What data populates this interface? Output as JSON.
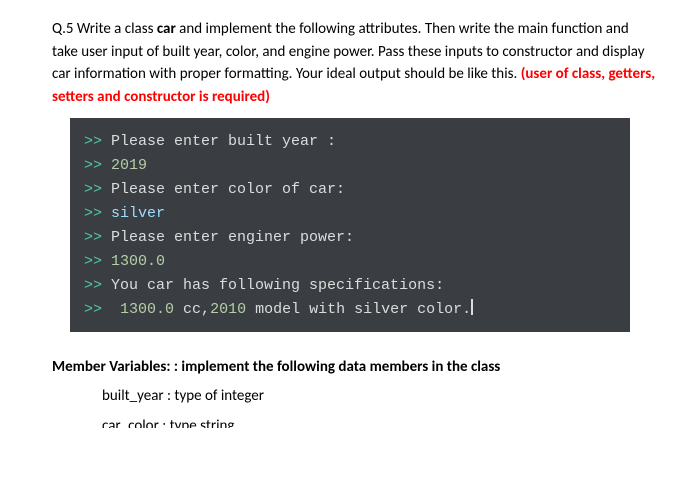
{
  "question": {
    "label": "Q.5",
    "part1": " Write a class ",
    "bold_word": "car",
    "part2": " and implement the following attributes. Then write the main function and take user input of built year, color, and engine power. Pass these inputs to constructor and display car information with proper formatting. Your ideal output should be like this. ",
    "red_text": "(user of class, getters, setters and constructor is required)"
  },
  "terminal": {
    "lines": [
      {
        "prompt": ">> ",
        "segments": [
          {
            "text": "Please enter built year :",
            "cls": "plain-text"
          }
        ]
      },
      {
        "prompt": ">> ",
        "segments": [
          {
            "text": "2019",
            "cls": "num-text"
          }
        ]
      },
      {
        "prompt": ">> ",
        "segments": [
          {
            "text": "Please enter color of car:",
            "cls": "plain-text"
          }
        ]
      },
      {
        "prompt": ">> ",
        "segments": [
          {
            "text": "silver",
            "cls": "cyan-text"
          }
        ]
      },
      {
        "prompt": ">> ",
        "segments": [
          {
            "text": "Please enter enginer power:",
            "cls": "plain-text"
          }
        ]
      },
      {
        "prompt": ">> ",
        "segments": [
          {
            "text": "1300.0",
            "cls": "num-text"
          }
        ]
      },
      {
        "prompt": ">> ",
        "segments": [
          {
            "text": "You car has following specifications:",
            "cls": "plain-text"
          }
        ]
      },
      {
        "prompt": ">> ",
        "segments": [
          {
            "text": " ",
            "cls": "plain-text"
          },
          {
            "text": "1300.0",
            "cls": "num-text"
          },
          {
            "text": " cc,",
            "cls": "plain-text"
          },
          {
            "text": "2010",
            "cls": "num-text"
          },
          {
            "text": " model with silver color.",
            "cls": "plain-text"
          }
        ],
        "cursor": true
      }
    ]
  },
  "members": {
    "heading": "Member Variables: : implement the following data members in the class",
    "items": [
      "built_year : type of integer",
      "car_color :    type string"
    ]
  }
}
